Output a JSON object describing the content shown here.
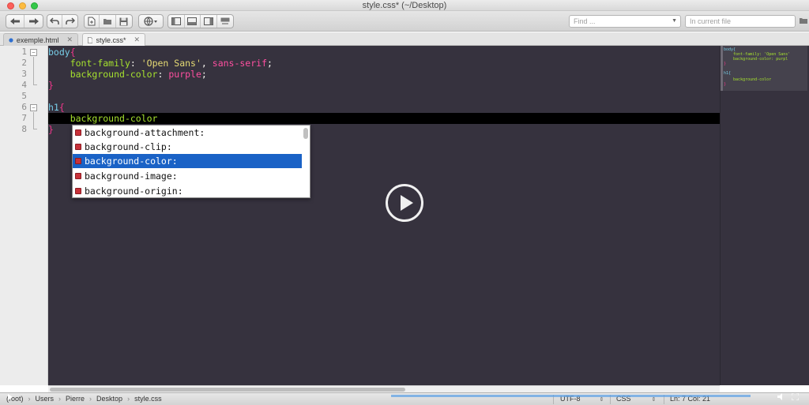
{
  "window": {
    "title": "style.css* (~/Desktop)"
  },
  "toolbar": {
    "find_placeholder": "Find ...",
    "in_current_file_placeholder": "In current file"
  },
  "tabs": [
    {
      "label": "exemple.html",
      "close": "✕",
      "active": false
    },
    {
      "label": "style.css*",
      "close": "✕",
      "active": true
    }
  ],
  "gutter": {
    "line_numbers": [
      "1",
      "2",
      "3",
      "4",
      "5",
      "6",
      "7",
      "8"
    ],
    "fold_markers": [
      "−",
      "−"
    ]
  },
  "code": {
    "line1": {
      "selector": "body",
      "brace": "{"
    },
    "line2": {
      "indent": "    ",
      "prop": "font-family",
      "colon": ": ",
      "str": "'Open Sans'",
      "comma": ", ",
      "value": "sans-serif",
      "semi": ";"
    },
    "line3": {
      "indent": "    ",
      "prop": "background-color",
      "colon": ": ",
      "value": "purple",
      "semi": ";"
    },
    "line4": {
      "brace": "}"
    },
    "line6": {
      "selector": "h1",
      "brace": "{"
    },
    "line7": {
      "indent": "    ",
      "prop": "background-color"
    },
    "line8": {
      "brace": "}"
    }
  },
  "autocomplete": {
    "items": [
      {
        "label": "background-attachment:",
        "selected": false
      },
      {
        "label": "background-clip:",
        "selected": false
      },
      {
        "label": "background-color:",
        "selected": true
      },
      {
        "label": "background-image:",
        "selected": false
      },
      {
        "label": "background-origin:",
        "selected": false
      }
    ]
  },
  "minimap": {
    "lines": [
      "body{",
      "    font-family: 'Open Sans'",
      "    background-color: purpl",
      "}",
      "",
      "h1{",
      "    background-color",
      "}"
    ]
  },
  "statusbar": {
    "breadcrumbs": [
      "(root)",
      "Users",
      "Pierre",
      "Desktop",
      "style.css"
    ],
    "separator": "›",
    "encoding": "UTF-8",
    "syntax": "CSS",
    "position": "Ln: 7 Col: 21"
  },
  "colors": {
    "editor_bg": "#36323e",
    "selector": "#78cfe9",
    "property": "#a6e22e",
    "string": "#e6db74",
    "keyword": "#f0378c",
    "autocomplete_selected": "#1a62c6"
  }
}
